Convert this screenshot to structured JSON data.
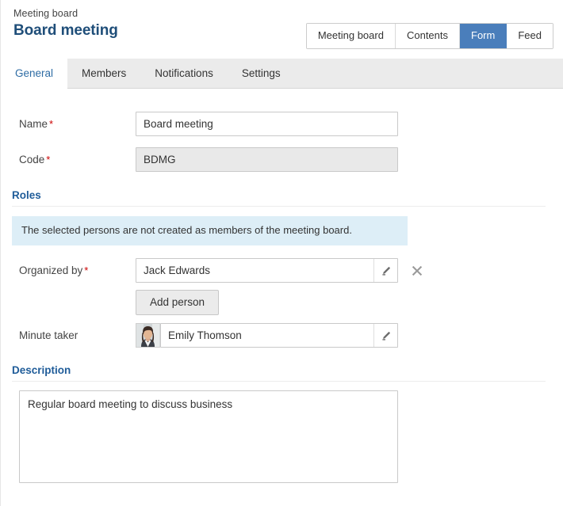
{
  "header": {
    "breadcrumb": "Meeting board",
    "title": "Board meeting",
    "views": [
      {
        "label": "Meeting board",
        "active": false
      },
      {
        "label": "Contents",
        "active": false
      },
      {
        "label": "Form",
        "active": true
      },
      {
        "label": "Feed",
        "active": false
      }
    ],
    "accent_color": "#4a7ebb",
    "title_color": "#1f4e79"
  },
  "tabs": [
    {
      "label": "General",
      "active": true
    },
    {
      "label": "Members",
      "active": false
    },
    {
      "label": "Notifications",
      "active": false
    },
    {
      "label": "Settings",
      "active": false
    }
  ],
  "form": {
    "name": {
      "label": "Name",
      "required_marker": "*",
      "value": "Board meeting"
    },
    "code": {
      "label": "Code",
      "required_marker": "*",
      "value": "BDMG",
      "readonly": true
    },
    "roles": {
      "section_title": "Roles",
      "info_message": "The selected persons are not created as members of the meeting board.",
      "info_background": "#ddeef7",
      "organized_by": {
        "label": "Organized by",
        "required_marker": "*",
        "value": "Jack Edwards",
        "edit_icon": "pencil-icon",
        "remove_icon": "close-icon"
      },
      "add_person_label": "Add person",
      "minute_taker": {
        "label": "Minute taker",
        "value": "Emily Thomson",
        "edit_icon": "pencil-icon",
        "avatar": "person-photo"
      }
    },
    "description": {
      "section_title": "Description",
      "value": "Regular board meeting to discuss business"
    }
  }
}
